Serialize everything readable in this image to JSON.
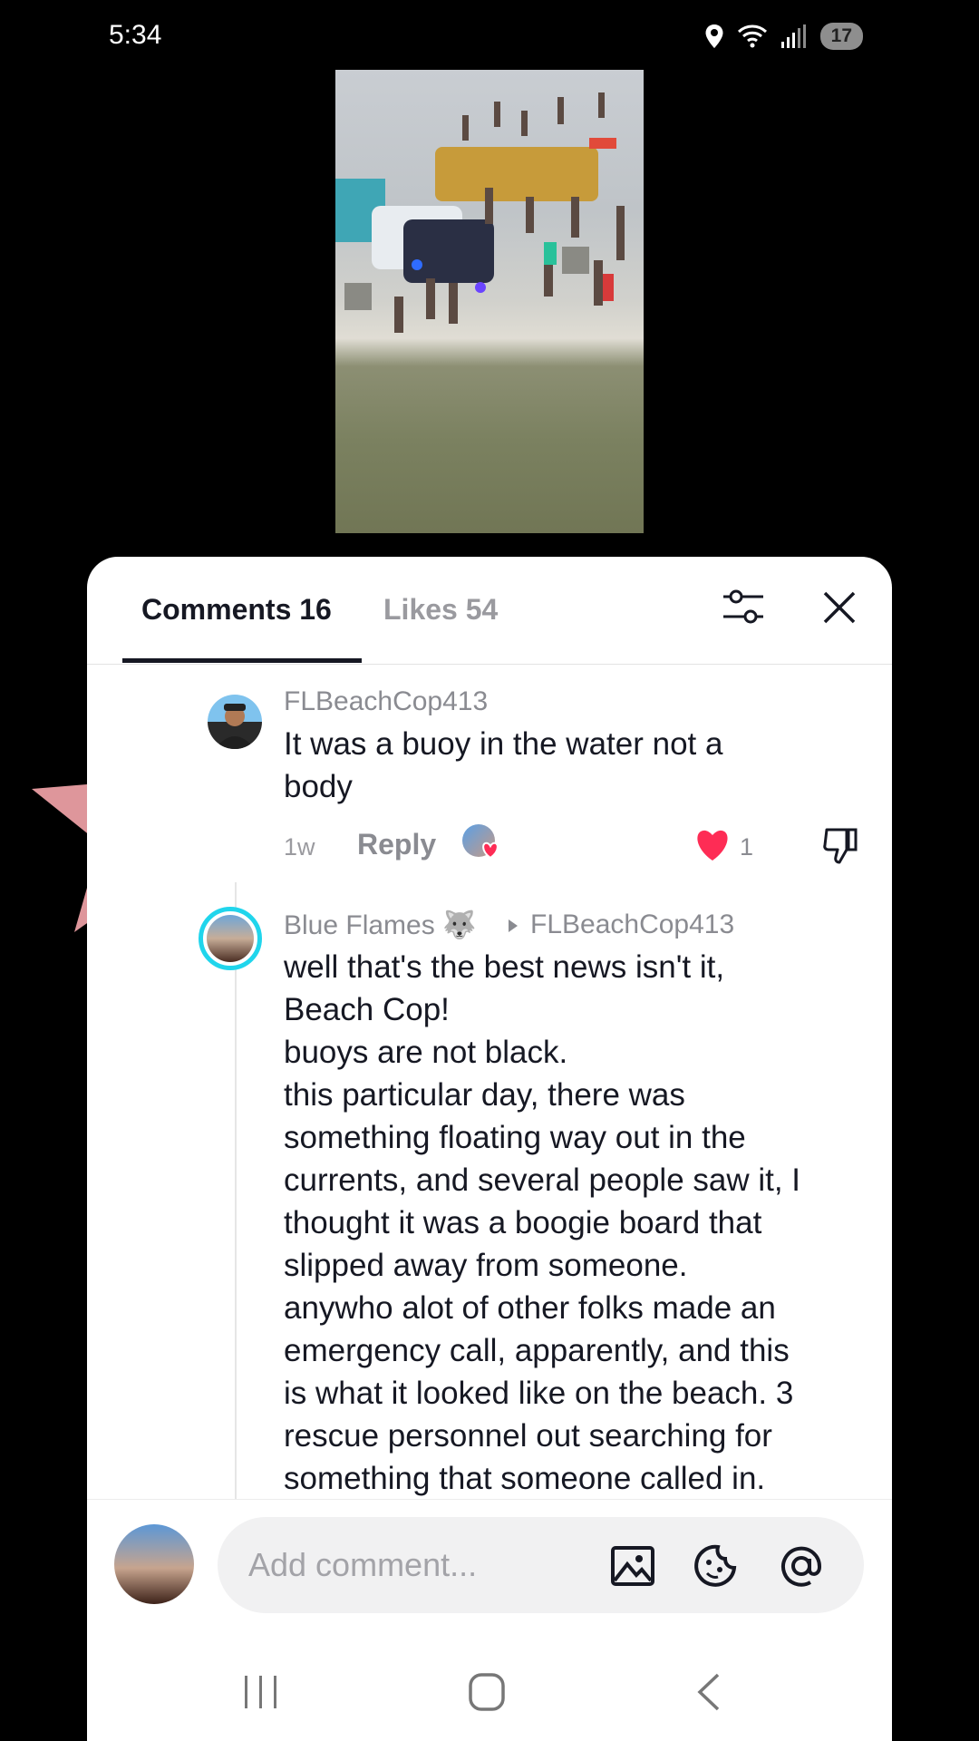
{
  "status": {
    "time": "5:34",
    "battery": "17"
  },
  "tabs": {
    "comments": "Comments 16",
    "likes": "Likes 54"
  },
  "comments": [
    {
      "username": "FLBeachCop413",
      "text": "It was a buoy in the water not a body",
      "time": "1w",
      "reply": "Reply",
      "likes": "1"
    },
    {
      "username": "Blue Flames 🐺",
      "reply_to": "FLBeachCop413",
      "lines": [
        "well that's the best news isn't it,",
        "Beach Cop!",
        "buoys are not black.",
        "this particular day, there was",
        "something floating way out in the",
        "currents, and several people saw it, I",
        "thought it was a boogie board that",
        "slipped away from someone.",
        "anywho alot of other folks made an",
        "emergency call, apparently, and this",
        "is what it looked like on the beach. 3",
        "rescue personnel out searching for",
        "something that someone called in."
      ]
    }
  ],
  "input": {
    "placeholder": "Add comment..."
  },
  "colors": {
    "heart": "#fe2c55",
    "avatar_ring": "#20d5ec",
    "text": "#161823",
    "muted": "#8a8b91"
  },
  "icons": [
    "location-icon",
    "wifi-icon",
    "signal-icon",
    "filter-icon",
    "close-icon",
    "heart-icon",
    "dislike-icon",
    "image-icon",
    "emoji-icon",
    "mention-icon",
    "recent-apps-icon",
    "home-icon",
    "back-icon"
  ]
}
